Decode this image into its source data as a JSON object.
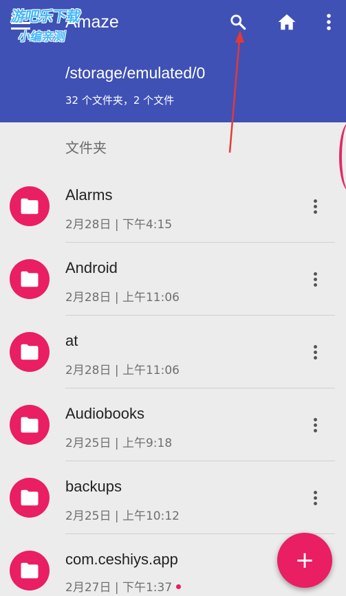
{
  "app": {
    "title": "Amaze",
    "watermark_line1": "游吧乐下载",
    "watermark_line2": "小编亲测"
  },
  "toolbar": {
    "menu_icon": "hamburger-menu-icon",
    "search_icon": "search-icon",
    "home_icon": "home-icon",
    "more_icon": "more-vert-icon"
  },
  "location": {
    "path": "/storage/emulated/0",
    "summary": "32 个文件夹，2 个文件"
  },
  "section": {
    "header": "文件夹"
  },
  "items": [
    {
      "name": "Alarms",
      "meta": "2月28日 | 下午4:15"
    },
    {
      "name": "Android",
      "meta": "2月28日 | 上午11:06"
    },
    {
      "name": "at",
      "meta": "2月28日 | 上午11:06"
    },
    {
      "name": "Audiobooks",
      "meta": "2月25日 | 上午9:18"
    },
    {
      "name": "backups",
      "meta": "2月25日 | 上午10:12"
    },
    {
      "name": "com.ceshiys.app",
      "meta": "2月27日 | 下午1:37"
    }
  ],
  "fab": {
    "label": "+"
  },
  "colors": {
    "appbar": "#3f51b5",
    "accent": "#e91e63",
    "background": "#ececec",
    "annotation_arrow": "#e53935"
  }
}
